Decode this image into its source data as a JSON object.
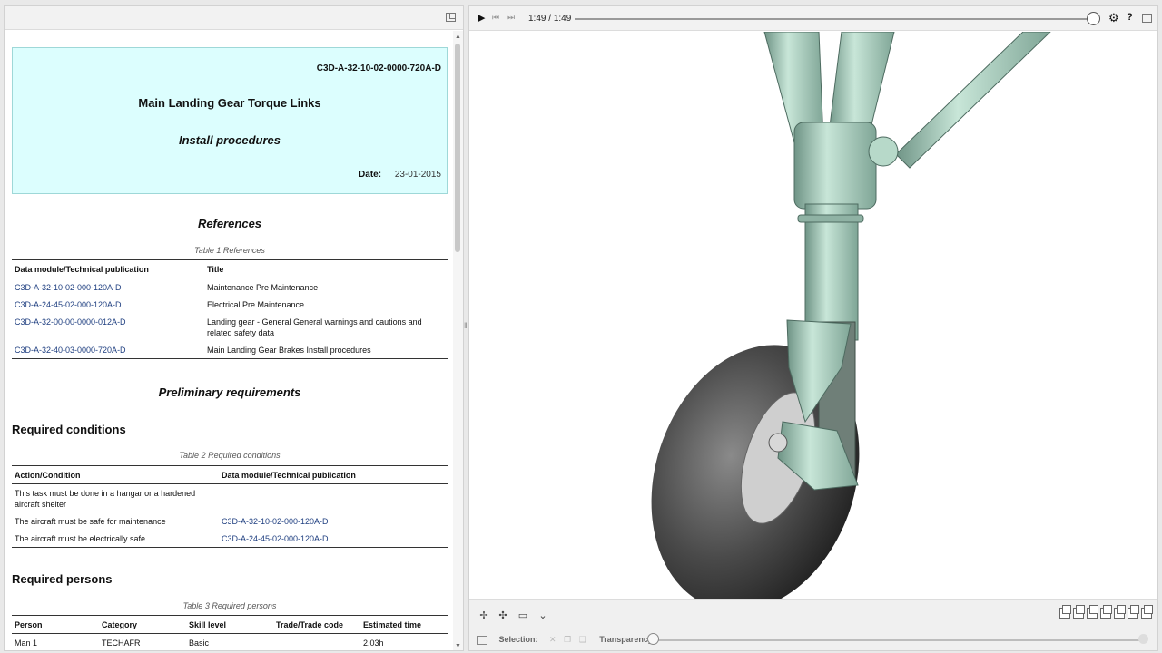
{
  "document": {
    "dmc": "C3D-A-32-10-02-0000-720A-D",
    "title": "Main Landing Gear Torque Links",
    "subtitle": "Install procedures",
    "date_label": "Date:",
    "date_value": "23-01-2015",
    "references": {
      "heading": "References",
      "caption": "Table 1 References",
      "headers": [
        "Data module/Technical publication",
        "Title"
      ],
      "rows": [
        [
          "C3D-A-32-10-02-000-120A-D",
          "Maintenance Pre Maintenance"
        ],
        [
          "C3D-A-24-45-02-000-120A-D",
          "Electrical Pre Maintenance"
        ],
        [
          "C3D-A-32-00-00-0000-012A-D",
          "Landing gear - General General warnings and cautions and related safety data"
        ],
        [
          "C3D-A-32-40-03-0000-720A-D",
          "Main Landing Gear Brakes Install procedures"
        ]
      ]
    },
    "prelim_heading": "Preliminary requirements",
    "conditions": {
      "heading": "Required conditions",
      "caption": "Table 2 Required conditions",
      "headers": [
        "Action/Condition",
        "Data module/Technical publication"
      ],
      "rows": [
        [
          "This task must be done in a hangar or a hardened aircraft shelter",
          ""
        ],
        [
          "The aircraft must be safe for maintenance",
          "C3D-A-32-10-02-000-120A-D"
        ],
        [
          "The aircraft must be electrically safe",
          "C3D-A-24-45-02-000-120A-D"
        ]
      ]
    },
    "persons": {
      "heading": "Required persons",
      "caption": "Table 3 Required persons",
      "headers": [
        "Person",
        "Category",
        "Skill level",
        "Trade/Trade code",
        "Estimated time"
      ],
      "rows": [
        [
          "Man 1",
          "TECHAFR",
          "Basic",
          "",
          "2.03h"
        ]
      ]
    }
  },
  "viewer": {
    "time_current": "1:49",
    "time_separator": "/",
    "time_total": "1:49",
    "progress_fraction": 1.0,
    "help_label": "?",
    "selection_label": "Selection:",
    "transparency_label": "Transparency:",
    "transparency_fraction": 0.0,
    "model_color": "#a9d2c0",
    "tire_color": "#4a4a4a"
  }
}
